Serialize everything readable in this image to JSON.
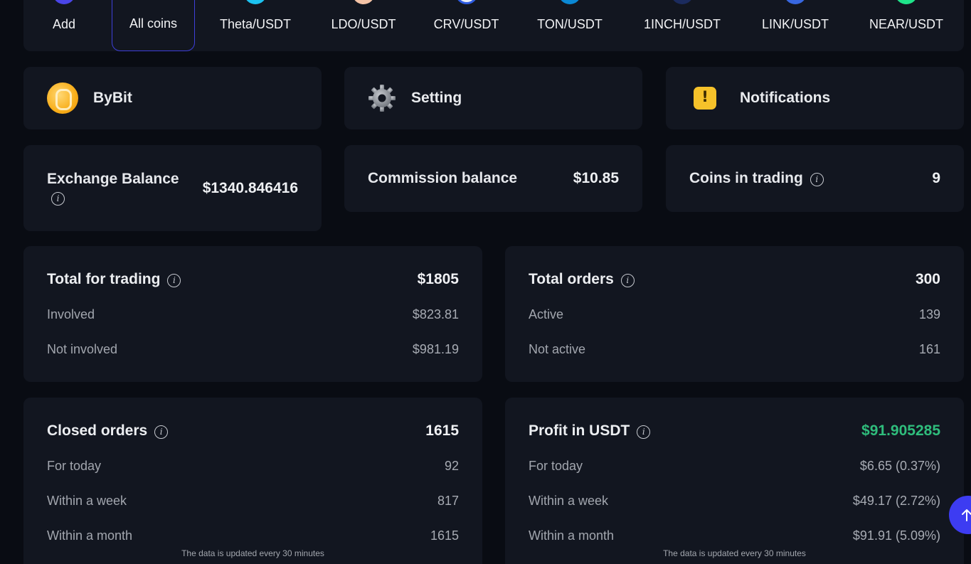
{
  "coins": [
    {
      "label": "Add",
      "color": "#4a45e8"
    },
    {
      "label": "All coins",
      "color": "",
      "active": true
    },
    {
      "label": "Theta/USDT",
      "color": "#1cc2f0"
    },
    {
      "label": "LDO/USDT",
      "color": "#f4c3a6"
    },
    {
      "label": "CRV/USDT",
      "color": "#e8ecf7"
    },
    {
      "label": "TON/USDT",
      "color": "#0a88d4"
    },
    {
      "label": "1INCH/USDT",
      "color": "#1b2b5e"
    },
    {
      "label": "LINK/USDT",
      "color": "#3867e0"
    },
    {
      "label": "NEAR/USDT",
      "color": "#1fe48a"
    }
  ],
  "nav": {
    "exchange": "ByBit",
    "setting": "Setting",
    "notifications": "Notifications"
  },
  "stats": {
    "exchange_balance": {
      "label": "Exchange Balance",
      "value": "$1340.846416"
    },
    "commission_balance": {
      "label": "Commission balance",
      "value": "$10.85"
    },
    "coins_in_trading": {
      "label": "Coins in trading",
      "value": "9"
    }
  },
  "total_for_trading": {
    "label": "Total for trading",
    "value": "$1805",
    "rows": [
      {
        "label": "Involved",
        "value": "$823.81"
      },
      {
        "label": "Not involved",
        "value": "$981.19"
      }
    ]
  },
  "total_orders": {
    "label": "Total orders",
    "value": "300",
    "rows": [
      {
        "label": "Active",
        "value": "139"
      },
      {
        "label": "Not active",
        "value": "161"
      }
    ]
  },
  "closed_orders": {
    "label": "Closed orders",
    "value": "1615",
    "rows": [
      {
        "label": "For today",
        "value": "92"
      },
      {
        "label": "Within a week",
        "value": "817"
      },
      {
        "label": "Within a month",
        "value": "1615"
      }
    ],
    "note": "The data is updated every 30 minutes"
  },
  "profit": {
    "label": "Profit in USDT",
    "value": "$91.905285",
    "value_color": "#2fbd7c",
    "rows": [
      {
        "label": "For today",
        "value": "$6.65 (0.37%)"
      },
      {
        "label": "Within a week",
        "value": "$49.17 (2.72%)"
      },
      {
        "label": "Within a month",
        "value": "$91.91 (5.09%)"
      }
    ],
    "note": "The data is updated every 30 minutes"
  },
  "icons": {
    "info": "info-icon",
    "bybit": "bybit-logo-icon",
    "setting": "gear-icon",
    "notifications": "warning-icon",
    "scroll_top": "arrow-up-icon"
  }
}
